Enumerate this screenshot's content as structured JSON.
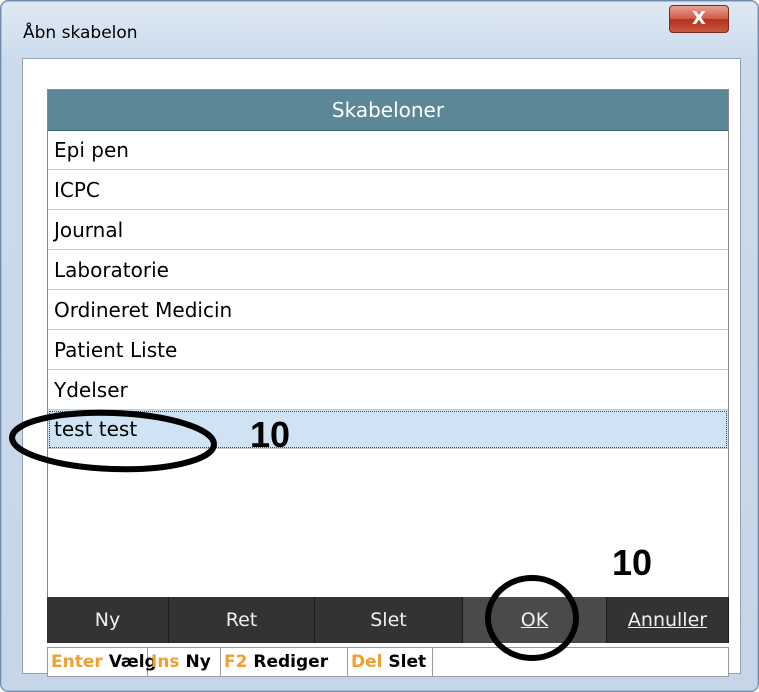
{
  "window": {
    "title": "Åbn skabelon",
    "close_glyph": "X"
  },
  "list": {
    "header": "Skabeloner",
    "items": [
      "Epi pen",
      "ICPC",
      "Journal",
      "Laboratorie",
      "Ordineret Medicin",
      "Patient Liste",
      "Ydelser",
      "test test"
    ],
    "selected": "test test"
  },
  "buttons": {
    "new": "Ny",
    "edit": "Ret",
    "delete": "Slet",
    "ok": "OK",
    "cancel": "Annuller"
  },
  "statusbar": [
    {
      "key": "Enter",
      "action": "Vælg"
    },
    {
      "key": "Ins",
      "action": "Ny"
    },
    {
      "key": "F2",
      "action": "Rediger"
    },
    {
      "key": "Del",
      "action": "Slet"
    }
  ],
  "annotations": {
    "row_note": "10",
    "ok_note": "10"
  },
  "colors": {
    "header_bg": "#5c8797",
    "button_bg": "#333333",
    "key_color": "#f0a030",
    "selected_row": "#cfe3f5"
  }
}
